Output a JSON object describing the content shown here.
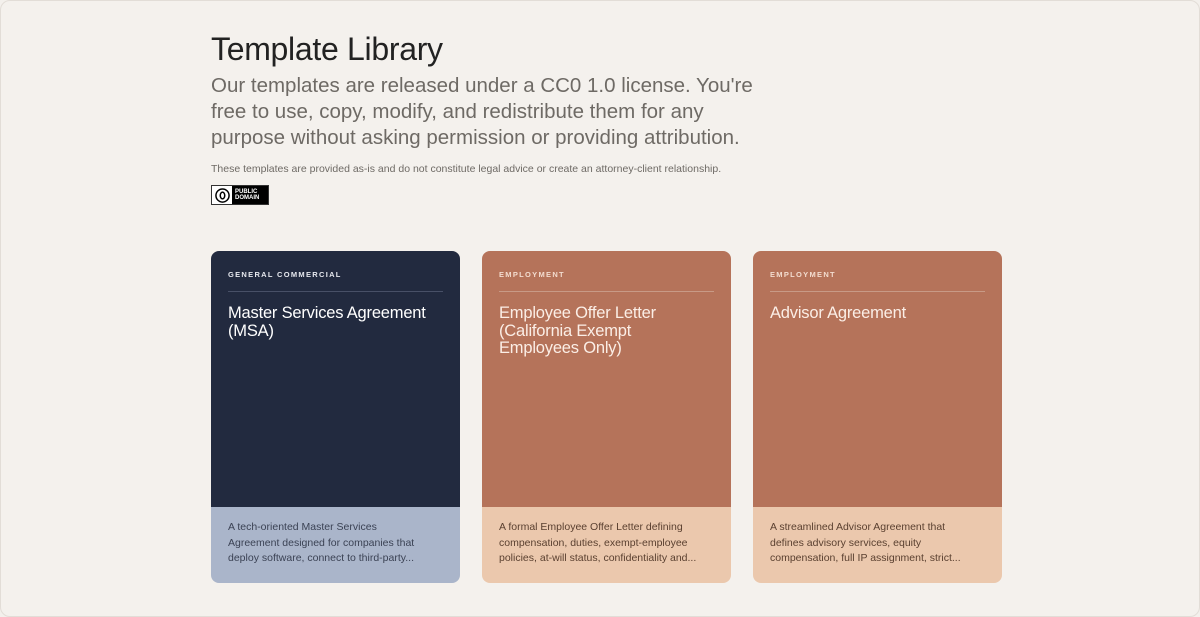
{
  "header": {
    "title": "Template Library",
    "intro": "Our templates are released under a CC0 1.0 license. You're free to use, copy, modify, and redistribute them for any purpose without asking permission or providing attribution.",
    "disclaimer": "These templates are provided as-is and do not constitute legal advice or create an attorney-client relationship.",
    "badge": {
      "line1": "PUBLIC",
      "line2": "DOMAIN",
      "icon": "cc-zero-icon"
    }
  },
  "cards": [
    {
      "category": "GENERAL COMMERCIAL",
      "title": "Master Services Agreement (MSA)",
      "description_lines": [
        "A tech-oriented Master Services",
        "Agreement designed for companies that",
        "deploy software, connect to third-party..."
      ]
    },
    {
      "category": "EMPLOYMENT",
      "title": "Employee Offer Letter (California Exempt Employees Only)",
      "description_lines": [
        "A formal Employee Offer Letter defining",
        "compensation, duties, exempt-employee",
        "policies, at-will status, confidentiality and..."
      ]
    },
    {
      "category": "EMPLOYMENT",
      "title": "Advisor Agreement",
      "description_lines": [
        "A streamlined Advisor Agreement that",
        "defines advisory services, equity",
        "compensation, full IP assignment, strict..."
      ]
    }
  ],
  "colors": {
    "background": "#f4f1ed",
    "navy_card": "#222a3f",
    "navy_card_bottom": "#aab5ca",
    "terra_card": "#b5735a",
    "terra_card_bottom": "#ebc8ad"
  }
}
